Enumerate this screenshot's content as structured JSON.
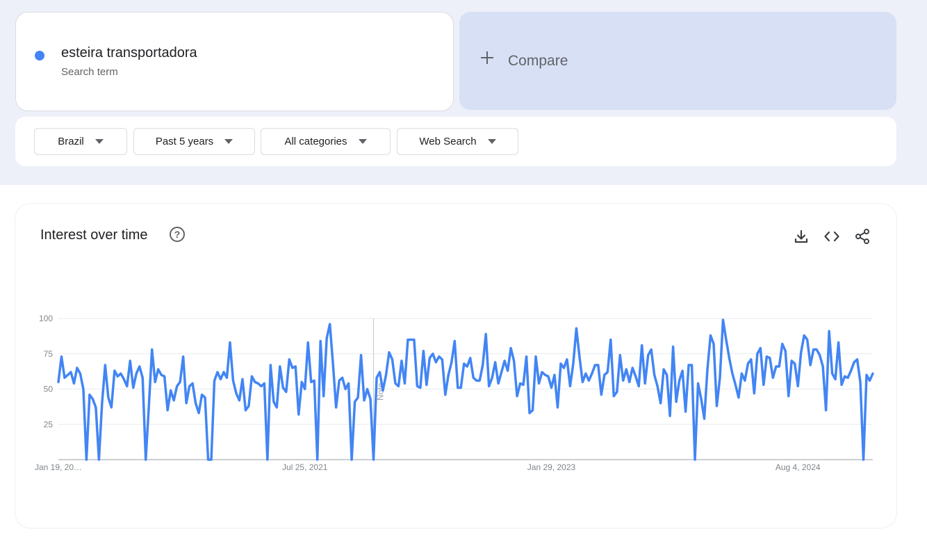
{
  "search_term": {
    "name": "esteira transportadora",
    "subtitle": "Search term",
    "color": "#4285f4"
  },
  "compare": {
    "label": "Compare"
  },
  "filters": [
    {
      "label": "Brazil"
    },
    {
      "label": "Past 5 years"
    },
    {
      "label": "All categories"
    },
    {
      "label": "Web Search"
    }
  ],
  "card": {
    "title": "Interest over time",
    "icons": [
      "help-icon",
      "download-icon",
      "embed-icon",
      "share-icon"
    ]
  },
  "chart_data": {
    "type": "line",
    "line_color": "#4285f4",
    "ylim": [
      0,
      100
    ],
    "y_ticks": [
      "100",
      "75",
      "50",
      "25"
    ],
    "x_tick_labels": [
      "Jan 19, 20…",
      "Jul 25, 2021",
      "Jan 29, 2023",
      "Aug 4, 2024"
    ],
    "x_tick_positions": [
      0,
      79,
      158,
      237
    ],
    "note_label": "Note",
    "note_index": 101,
    "grid": true,
    "series": [
      {
        "values": [
          55,
          73,
          58,
          60,
          62,
          54,
          65,
          61,
          50,
          0,
          46,
          43,
          37,
          0,
          40,
          67,
          44,
          37,
          63,
          59,
          61,
          57,
          52,
          70,
          51,
          61,
          66,
          58,
          0,
          38,
          78,
          55,
          64,
          60,
          59,
          35,
          49,
          42,
          52,
          55,
          73,
          40,
          52,
          54,
          40,
          33,
          46,
          44,
          0,
          0,
          56,
          62,
          57,
          62,
          58,
          83,
          56,
          47,
          42,
          57,
          35,
          38,
          59,
          55,
          54,
          52,
          54,
          0,
          67,
          41,
          37,
          66,
          51,
          48,
          71,
          65,
          66,
          32,
          55,
          50,
          83,
          55,
          56,
          0,
          84,
          45,
          86,
          96,
          68,
          37,
          56,
          58,
          50,
          54,
          0,
          41,
          44,
          74,
          42,
          50,
          43,
          0,
          58,
          62,
          49,
          60,
          76,
          71,
          54,
          52,
          70,
          54,
          85,
          85,
          85,
          52,
          51,
          77,
          53,
          72,
          75,
          69,
          73,
          71,
          46,
          60,
          69,
          84,
          51,
          51,
          68,
          66,
          72,
          58,
          56,
          56,
          67,
          89,
          52,
          58,
          69,
          54,
          62,
          70,
          63,
          79,
          70,
          45,
          54,
          53,
          73,
          33,
          35,
          73,
          54,
          62,
          60,
          59,
          51,
          60,
          37,
          68,
          65,
          71,
          52,
          68,
          93,
          73,
          55,
          61,
          56,
          61,
          67,
          67,
          46,
          60,
          62,
          85,
          45,
          48,
          74,
          56,
          64,
          55,
          65,
          59,
          52,
          81,
          54,
          74,
          78,
          60,
          52,
          40,
          64,
          60,
          31,
          80,
          41,
          56,
          63,
          34,
          67,
          67,
          0,
          54,
          43,
          29,
          64,
          88,
          82,
          38,
          58,
          99,
          85,
          72,
          61,
          53,
          44,
          61,
          56,
          68,
          71,
          47,
          75,
          79,
          53,
          73,
          72,
          58,
          66,
          66,
          82,
          77,
          45,
          70,
          68,
          52,
          76,
          88,
          85,
          67,
          78,
          78,
          74,
          66,
          35,
          91,
          61,
          57,
          83,
          53,
          59,
          58,
          63,
          69,
          71,
          55,
          0,
          60,
          56,
          61
        ]
      }
    ]
  }
}
